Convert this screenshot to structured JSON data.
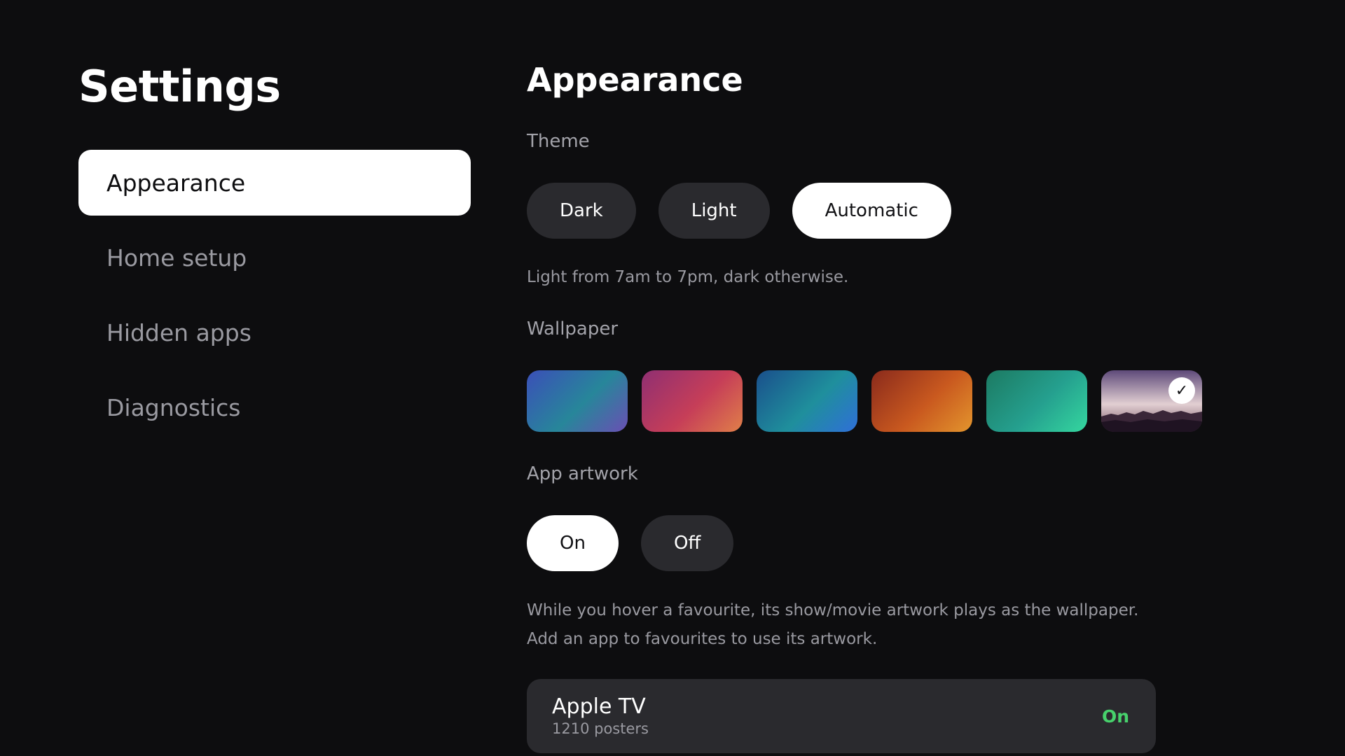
{
  "page_title": "Settings",
  "sidebar": {
    "items": [
      {
        "label": "Appearance",
        "active": true
      },
      {
        "label": "Home setup",
        "active": false
      },
      {
        "label": "Hidden apps",
        "active": false
      },
      {
        "label": "Diagnostics",
        "active": false
      }
    ]
  },
  "main": {
    "title": "Appearance",
    "theme": {
      "label": "Theme",
      "options": [
        "Dark",
        "Light",
        "Automatic"
      ],
      "selected": "Automatic",
      "description": "Light from 7am to 7pm, dark otherwise."
    },
    "wallpaper": {
      "label": "Wallpaper",
      "swatches": [
        {
          "colors": [
            "#3b4fb8",
            "#27869a",
            "#6a4fb4"
          ],
          "selected": false
        },
        {
          "colors": [
            "#8f2f72",
            "#c63e58",
            "#e07f49"
          ],
          "selected": false
        },
        {
          "colors": [
            "#1a4f8c",
            "#1f8f9c",
            "#2f6fd8"
          ],
          "selected": false
        },
        {
          "colors": [
            "#8a2a1c",
            "#c9591f",
            "#e3952d"
          ],
          "selected": false
        },
        {
          "colors": [
            "#1c7a62",
            "#25a08f",
            "#35d79f"
          ],
          "selected": false
        },
        {
          "colors": [
            "#6f5a86",
            "#d8c4c8",
            "#2b1b2e"
          ],
          "selected": true
        }
      ]
    },
    "app_artwork": {
      "label": "App artwork",
      "options": [
        "On",
        "Off"
      ],
      "selected": "On",
      "description": "While you hover a favourite, its show/movie artwork plays as the wallpaper. Add an app to favourites to use its artwork."
    },
    "apps": [
      {
        "name": "Apple TV",
        "subtitle": "1210 posters",
        "status": "On"
      }
    ]
  },
  "colors": {
    "background": "#0d0d0f",
    "pill": "#2a2a2e",
    "status_on": "#47d16c"
  }
}
